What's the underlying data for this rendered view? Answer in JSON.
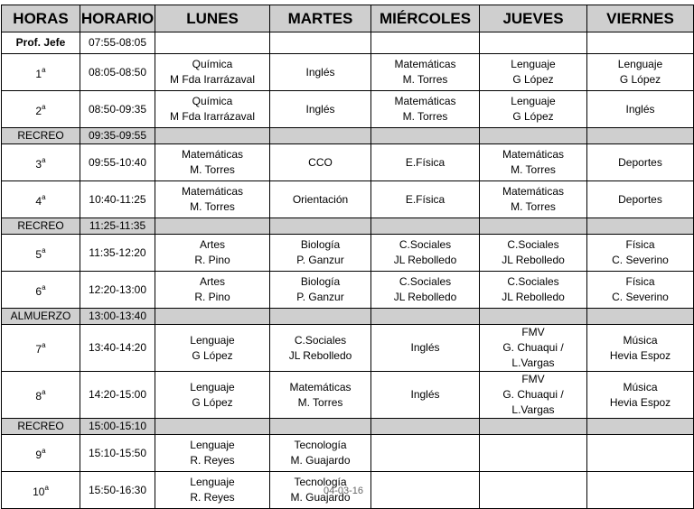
{
  "header": [
    "HORAS",
    "HORARIO",
    "LUNES",
    "MARTES",
    "MIÉRCOLES",
    "JUEVES",
    "VIERNES"
  ],
  "prof_row": {
    "label": "Prof. Jefe",
    "time": "07:55-08:05"
  },
  "rows": [
    {
      "type": "class",
      "num": "1",
      "sup": "a",
      "time": "08:05-08:50",
      "cells": [
        [
          "Química",
          "M Fda Irarrázaval"
        ],
        [
          "Inglés"
        ],
        [
          "Matemáticas",
          "M. Torres"
        ],
        [
          "Lenguaje",
          "G López"
        ],
        [
          "Lenguaje",
          "G López"
        ]
      ]
    },
    {
      "type": "class",
      "num": "2",
      "sup": "a",
      "time": "08:50-09:35",
      "cells": [
        [
          "Química",
          "M Fda Irarrázaval"
        ],
        [
          "Inglés"
        ],
        [
          "Matemáticas",
          "M. Torres"
        ],
        [
          "Lenguaje",
          "G López"
        ],
        [
          "Inglés"
        ]
      ]
    },
    {
      "type": "break",
      "label": "RECREO",
      "time": "09:35-09:55"
    },
    {
      "type": "class",
      "num": "3",
      "sup": "a",
      "time": "09:55-10:40",
      "cells": [
        [
          "Matemáticas",
          "M. Torres"
        ],
        [
          "CCO"
        ],
        [
          "E.Física"
        ],
        [
          "Matemáticas",
          "M. Torres"
        ],
        [
          "Deportes"
        ]
      ]
    },
    {
      "type": "class",
      "num": "4",
      "sup": "a",
      "time": "10:40-11:25",
      "cells": [
        [
          "Matemáticas",
          "M. Torres"
        ],
        [
          "Orientación"
        ],
        [
          "E.Física"
        ],
        [
          "Matemáticas",
          "M. Torres"
        ],
        [
          "Deportes"
        ]
      ]
    },
    {
      "type": "break",
      "label": "RECREO",
      "time": "11:25-11:35"
    },
    {
      "type": "class",
      "num": "5",
      "sup": "a",
      "time": "11:35-12:20",
      "cells": [
        [
          "Artes",
          "R. Pino"
        ],
        [
          "Biología",
          "P. Ganzur"
        ],
        [
          "C.Sociales",
          "JL Rebolledo"
        ],
        [
          "C.Sociales",
          "JL Rebolledo"
        ],
        [
          "Física",
          "C. Severino"
        ]
      ]
    },
    {
      "type": "class",
      "num": "6",
      "sup": "a",
      "time": "12:20-13:00",
      "cells": [
        [
          "Artes",
          "R. Pino"
        ],
        [
          "Biología",
          "P. Ganzur"
        ],
        [
          "C.Sociales",
          "JL Rebolledo"
        ],
        [
          "C.Sociales",
          "JL Rebolledo"
        ],
        [
          "Física",
          "C. Severino"
        ]
      ]
    },
    {
      "type": "break",
      "label": "ALMUERZO",
      "time": "13:00-13:40"
    },
    {
      "type": "class",
      "num": "7",
      "sup": "a",
      "time": "13:40-14:20",
      "cells": [
        [
          "Lenguaje",
          "G López"
        ],
        [
          "C.Sociales",
          "JL Rebolledo"
        ],
        [
          "Inglés"
        ],
        [
          "FMV",
          "G. Chuaqui /",
          "L.Vargas"
        ],
        [
          "Música",
          "Hevia Espoz"
        ]
      ]
    },
    {
      "type": "class",
      "num": "8",
      "sup": "a",
      "time": "14:20-15:00",
      "cells": [
        [
          "Lenguaje",
          "G López"
        ],
        [
          "Matemáticas",
          "M. Torres"
        ],
        [
          "Inglés"
        ],
        [
          "FMV",
          "G. Chuaqui /",
          "L.Vargas"
        ],
        [
          "Música",
          "Hevia Espoz"
        ]
      ]
    },
    {
      "type": "break",
      "label": "RECREO",
      "time": "15:00-15:10"
    },
    {
      "type": "class",
      "num": "9",
      "sup": "a",
      "time": "15:10-15:50",
      "cells": [
        [
          "Lenguaje",
          "R. Reyes"
        ],
        [
          "Tecnología",
          "M. Guajardo"
        ],
        [],
        [],
        []
      ]
    },
    {
      "type": "class",
      "num": "10",
      "sup": "a",
      "time": "15:50-16:30",
      "cells": [
        [
          "Lenguaje",
          "R. Reyes"
        ],
        [
          "Tecnología",
          "M. Guajardo"
        ],
        [],
        [],
        []
      ]
    }
  ],
  "date_stamp": "04-03-16"
}
